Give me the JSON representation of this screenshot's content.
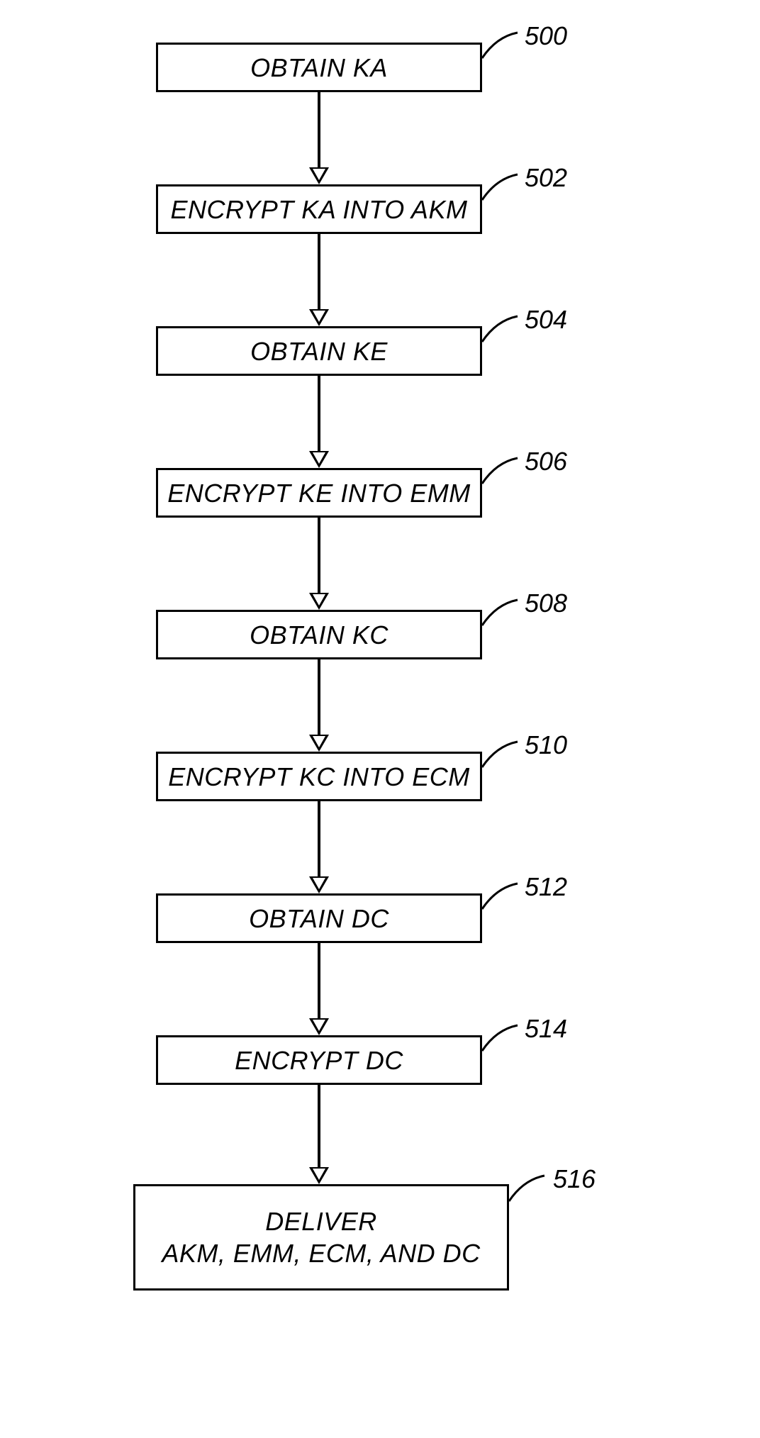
{
  "steps": [
    {
      "label": "OBTAIN KA",
      "ref": "500"
    },
    {
      "label": "ENCRYPT KA INTO AKM",
      "ref": "502"
    },
    {
      "label": "OBTAIN KE",
      "ref": "504"
    },
    {
      "label": "ENCRYPT KE INTO EMM",
      "ref": "506"
    },
    {
      "label": "OBTAIN KC",
      "ref": "508"
    },
    {
      "label": "ENCRYPT KC INTO ECM",
      "ref": "510"
    },
    {
      "label": "OBTAIN DC",
      "ref": "512"
    },
    {
      "label": "ENCRYPT DC",
      "ref": "514"
    },
    {
      "label": "DELIVER\nAKM, EMM, ECM, AND DC",
      "ref": "516"
    }
  ]
}
